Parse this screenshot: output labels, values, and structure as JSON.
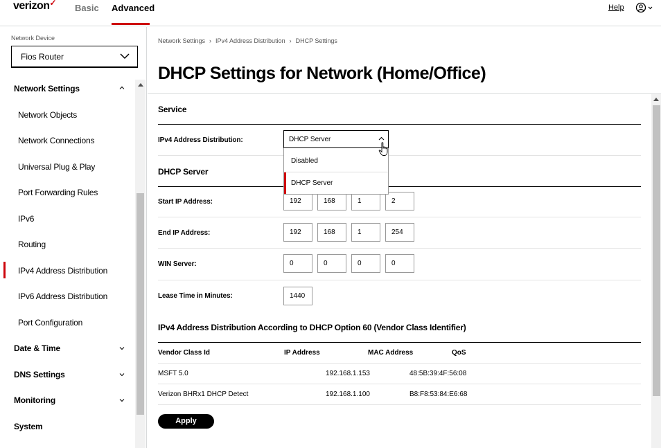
{
  "header": {
    "brand": "verizon",
    "brand_mark": "✓",
    "tabs": [
      {
        "label": "Basic"
      },
      {
        "label": "Advanced"
      }
    ],
    "help_label": "Help"
  },
  "sidebar": {
    "device_label": "Network Device",
    "device_value": "Fios Router",
    "sections": [
      {
        "label": "Network Settings",
        "expanded": true,
        "items": [
          {
            "label": "Network Objects"
          },
          {
            "label": "Network Connections"
          },
          {
            "label": "Universal Plug & Play"
          },
          {
            "label": "Port Forwarding Rules"
          },
          {
            "label": "IPv6"
          },
          {
            "label": "Routing"
          },
          {
            "label": "IPv4 Address Distribution",
            "active": true
          },
          {
            "label": "IPv6 Address Distribution"
          },
          {
            "label": "Port Configuration"
          }
        ]
      },
      {
        "label": "Date & Time",
        "expanded": false
      },
      {
        "label": "DNS Settings",
        "expanded": false
      },
      {
        "label": "Monitoring",
        "expanded": false
      },
      {
        "label": "System"
      }
    ]
  },
  "breadcrumb": [
    "Network Settings",
    "IPv4 Address Distribution",
    "DHCP Settings"
  ],
  "page_title": "DHCP Settings for Network (Home/Office)",
  "service": {
    "title": "Service",
    "distribution_label": "IPv4 Address Distribution:",
    "distribution_value": "DHCP Server",
    "options": [
      "Disabled",
      "DHCP Server"
    ]
  },
  "dhcp_server": {
    "title": "DHCP Server",
    "start_label": "Start IP Address:",
    "start_ip": [
      "192",
      "168",
      "1",
      "2"
    ],
    "end_label": "End IP Address:",
    "end_ip": [
      "192",
      "168",
      "1",
      "254"
    ],
    "win_label": "WIN Server:",
    "win_ip": [
      "0",
      "0",
      "0",
      "0"
    ],
    "lease_label": "Lease Time in Minutes:",
    "lease_value": "1440"
  },
  "vendor": {
    "title": "IPv4 Address Distribution According to DHCP Option 60 (Vendor Class Identifier)",
    "columns": [
      "Vendor Class Id",
      "IP Address",
      "MAC Address",
      "QoS"
    ],
    "rows": [
      {
        "vendor": "MSFT 5.0",
        "ip": "192.168.1.153",
        "mac": "48:5B:39:4F:56:08"
      },
      {
        "vendor": "Verizon BHRx1 DHCP Detect",
        "ip": "192.168.1.100",
        "mac": "B8:F8:53:84:E6:68"
      }
    ]
  },
  "apply_label": "Apply",
  "colors": {
    "accent": "#cd040b",
    "border": "#d8dadb"
  }
}
